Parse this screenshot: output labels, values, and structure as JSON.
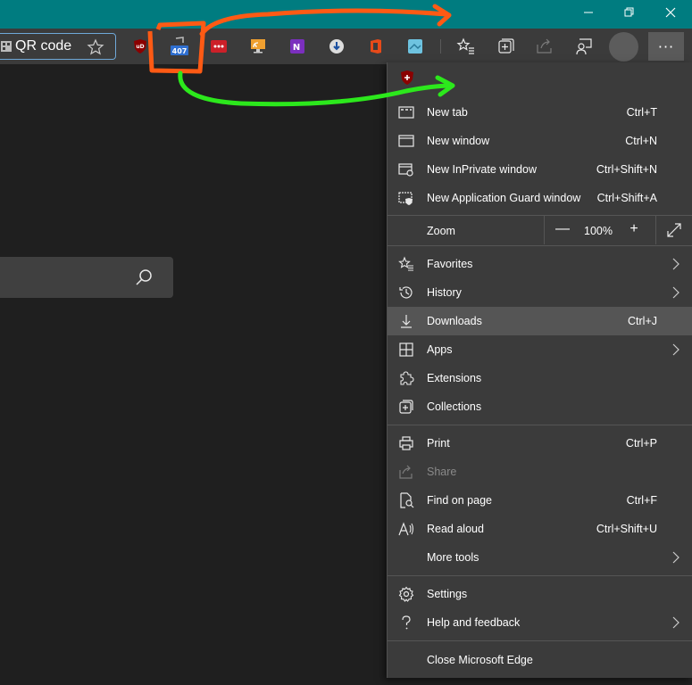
{
  "window": {
    "controls": [
      "minimize",
      "restore",
      "close"
    ]
  },
  "address_bar": {
    "text": "QR code"
  },
  "extensions": {
    "ublock_label": "uD",
    "proxy_badge": "407",
    "lastpass_label": "•••"
  },
  "menu": {
    "items": [
      {
        "label": "New tab",
        "shortcut": "Ctrl+T"
      },
      {
        "label": "New window",
        "shortcut": "Ctrl+N"
      },
      {
        "label": "New InPrivate window",
        "shortcut": "Ctrl+Shift+N"
      },
      {
        "label": "New Application Guard window",
        "shortcut": "Ctrl+Shift+A"
      },
      {
        "label": "Favorites",
        "shortcut": ""
      },
      {
        "label": "History",
        "shortcut": ""
      },
      {
        "label": "Downloads",
        "shortcut": "Ctrl+J"
      },
      {
        "label": "Apps",
        "shortcut": ""
      },
      {
        "label": "Extensions",
        "shortcut": ""
      },
      {
        "label": "Collections",
        "shortcut": ""
      },
      {
        "label": "Print",
        "shortcut": "Ctrl+P"
      },
      {
        "label": "Share",
        "shortcut": ""
      },
      {
        "label": "Find on page",
        "shortcut": "Ctrl+F"
      },
      {
        "label": "Read aloud",
        "shortcut": "Ctrl+Shift+U"
      },
      {
        "label": "More tools",
        "shortcut": ""
      },
      {
        "label": "Settings",
        "shortcut": ""
      },
      {
        "label": "Help and feedback",
        "shortcut": ""
      },
      {
        "label": "Close Microsoft Edge",
        "shortcut": ""
      }
    ],
    "zoom": {
      "label": "Zoom",
      "minus": "—",
      "value": "100%",
      "plus": "+"
    }
  },
  "colors": {
    "titlebar": "#007c80",
    "annotation_orange": "#ff5a14",
    "annotation_green": "#2ce81c"
  }
}
